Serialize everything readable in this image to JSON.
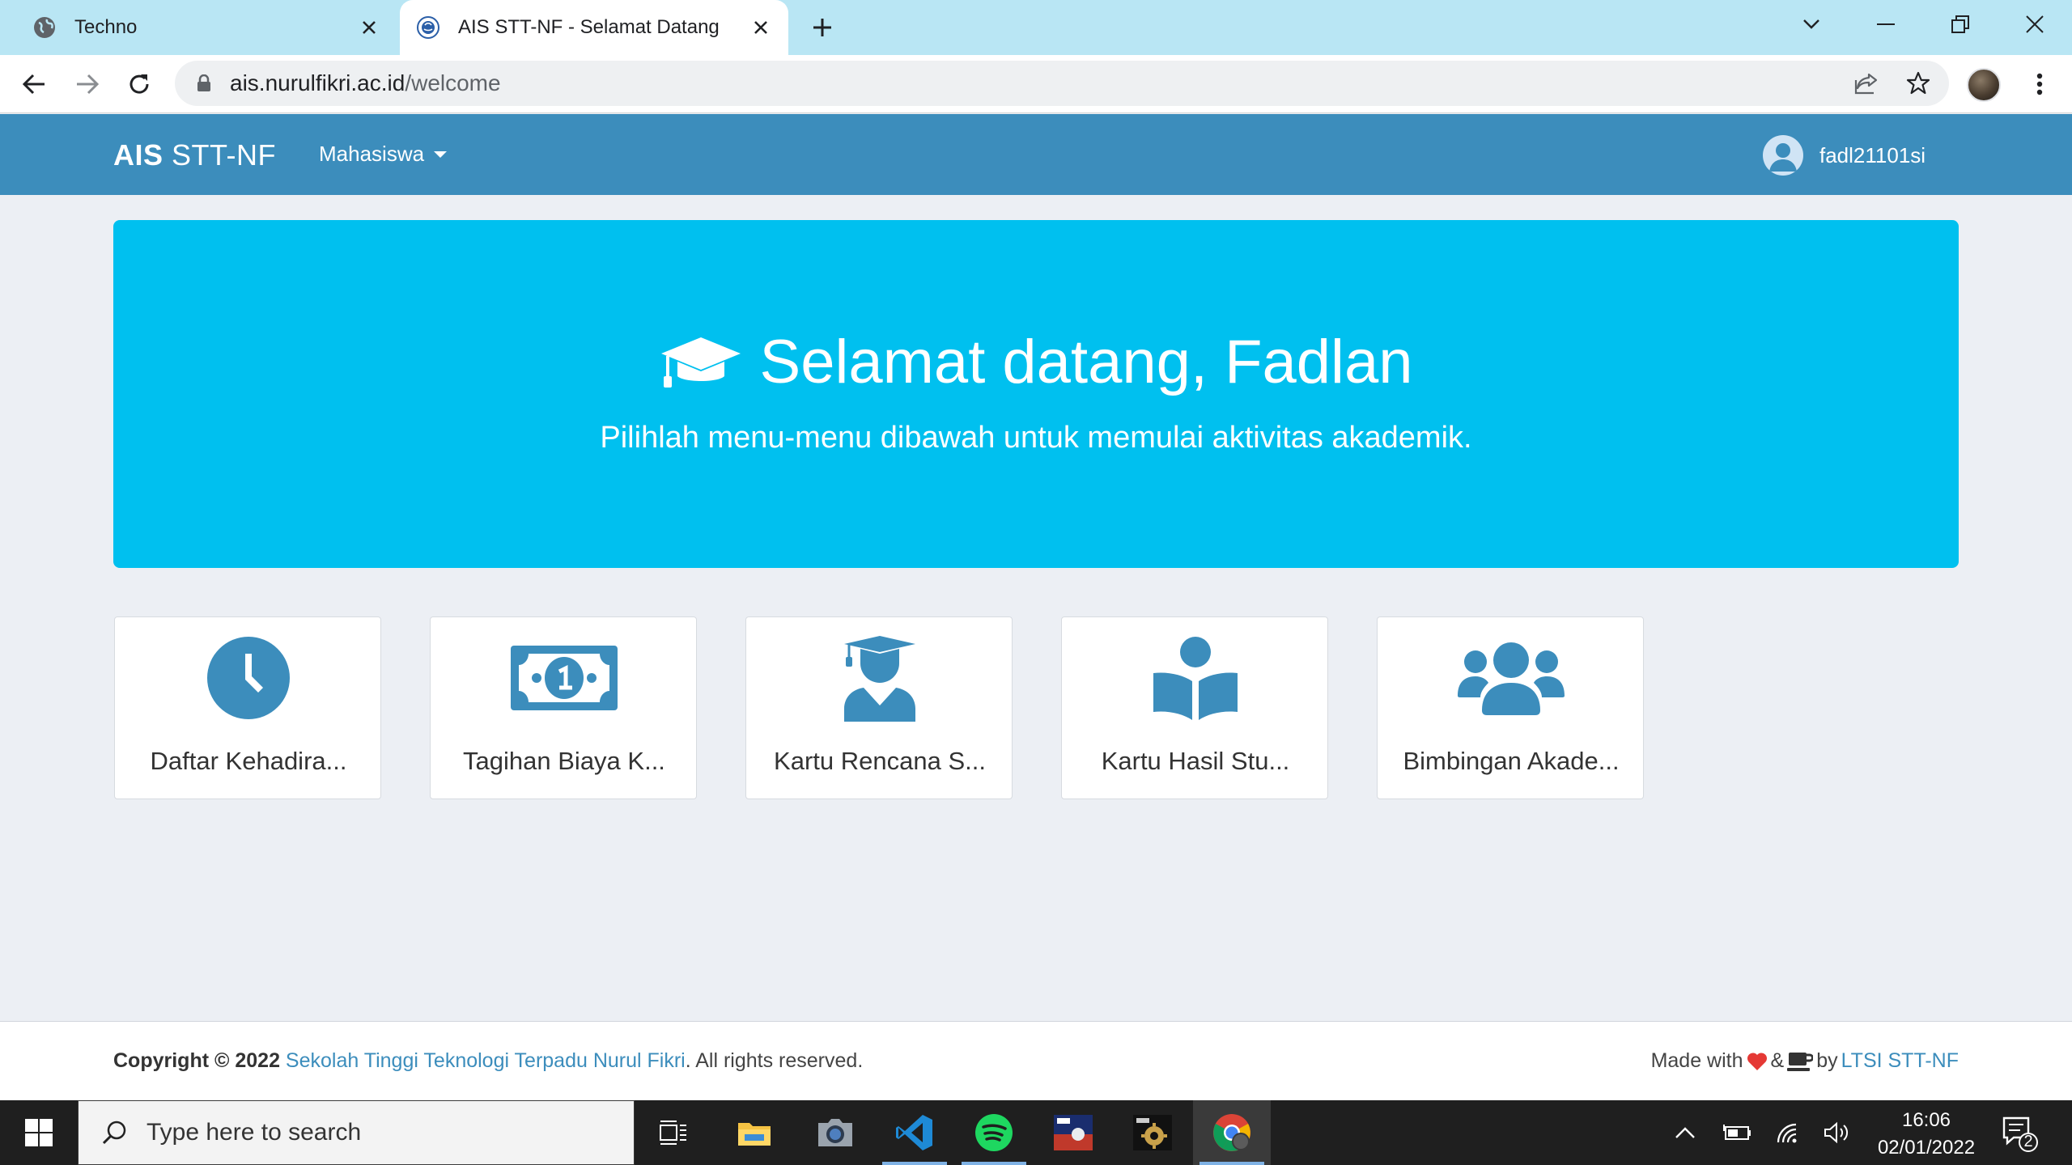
{
  "browser": {
    "tabs": [
      {
        "title": "Techno",
        "active": false
      },
      {
        "title": "AIS STT-NF - Selamat Datang",
        "active": true
      }
    ],
    "url_domain": "ais.nurulfikri.ac.id",
    "url_path": "/welcome"
  },
  "navbar": {
    "brand_bold": "AIS",
    "brand_rest": " STT-NF",
    "menu_label": "Mahasiswa",
    "username": "fadl21101si"
  },
  "hero": {
    "title": "Selamat datang, Fadlan",
    "subtitle": "Pilihlah menu-menu dibawah untuk memulai aktivitas akademik."
  },
  "cards": [
    {
      "label": "Daftar Kehadira...",
      "icon": "clock-icon"
    },
    {
      "label": "Tagihan Biaya K...",
      "icon": "money-bill-icon"
    },
    {
      "label": "Kartu Rencana S...",
      "icon": "graduate-icon"
    },
    {
      "label": "Kartu Hasil Stu...",
      "icon": "reader-icon"
    },
    {
      "label": "Bimbingan Akade...",
      "icon": "users-icon"
    }
  ],
  "footer": {
    "copyright_prefix": "Copyright © 2022 ",
    "institution": "Sekolah Tinggi Teknologi Terpadu Nurul Fikri",
    "rights": ". All rights reserved.",
    "made_with": "Made with",
    "amp": "&",
    "by": "by",
    "team": "LTSI STT-NF"
  },
  "taskbar": {
    "search_placeholder": "Type here to search",
    "time": "16:06",
    "date": "02/01/2022",
    "notification_count": "2"
  },
  "colors": {
    "navbar": "#3c8dbc",
    "hero": "#00c0ef",
    "icon_blue": "#3c8dbc"
  }
}
